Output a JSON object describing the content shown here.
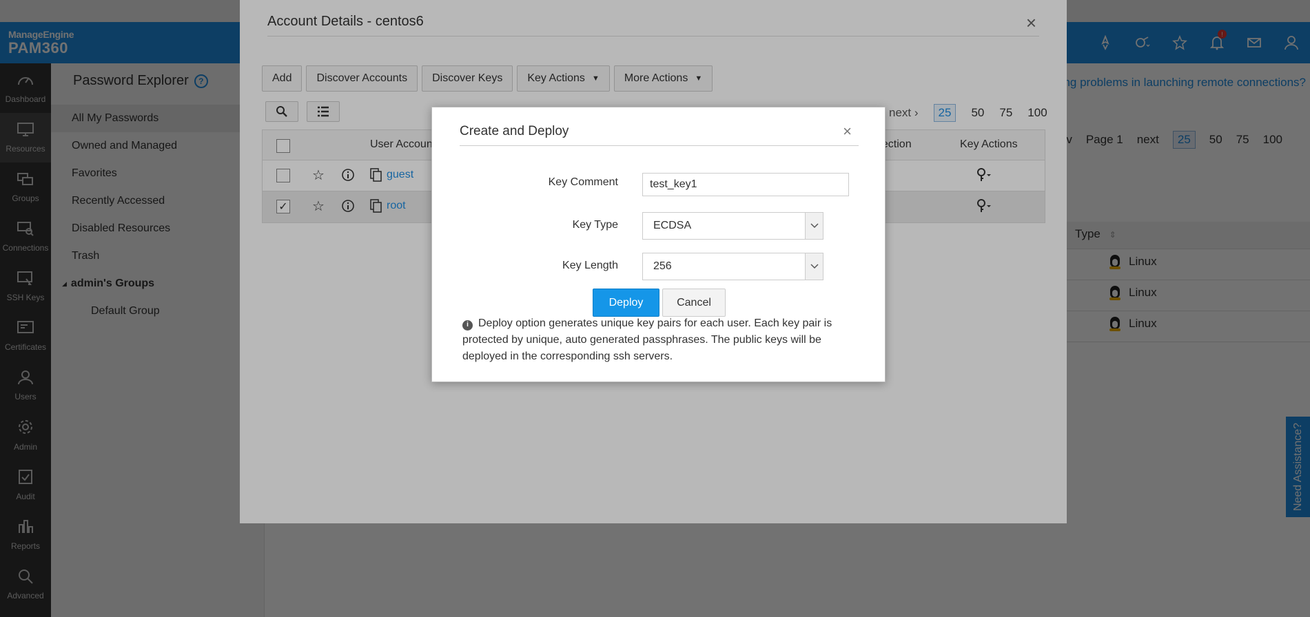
{
  "app": {
    "brand_top": "ManageEngine",
    "brand_name": "PAM360"
  },
  "header_icons": [
    "rocket-icon",
    "connection-icon",
    "user-star-icon",
    "bell-icon",
    "mail-icon",
    "user-icon"
  ],
  "notification_badge": "!",
  "leftnav": [
    {
      "label": "Dashboard",
      "icon": "dashboard-icon"
    },
    {
      "label": "Resources",
      "icon": "monitor-icon"
    },
    {
      "label": "Groups",
      "icon": "groups-icon"
    },
    {
      "label": "Connections",
      "icon": "connections-icon"
    },
    {
      "label": "SSH Keys",
      "icon": "ssh-key-icon"
    },
    {
      "label": "Certificates",
      "icon": "certificate-icon"
    },
    {
      "label": "Users",
      "icon": "user-icon"
    },
    {
      "label": "Admin",
      "icon": "gear-icon"
    },
    {
      "label": "Audit",
      "icon": "audit-icon"
    },
    {
      "label": "Reports",
      "icon": "reports-icon"
    },
    {
      "label": "Advanced",
      "icon": "analytics-icon"
    }
  ],
  "sidebar": {
    "title": "Password Explorer",
    "help": "?",
    "items": [
      "All My Passwords",
      "Owned and Managed",
      "Favorites",
      "Recently Accessed",
      "Disabled Resources",
      "Trash"
    ],
    "group_title": "admin's Groups",
    "group_items": [
      "Default Group"
    ]
  },
  "main": {
    "banner": "…ting problems in launching remote connections?",
    "pager": {
      "prev": "prev",
      "page": "Page 1",
      "next": "next",
      "sizes": [
        "25",
        "50",
        "75",
        "100"
      ]
    },
    "type_header": "Type",
    "type_rows": [
      "Linux",
      "Linux",
      "Linux"
    ]
  },
  "need_assistance": "Need Assistance?",
  "account_modal": {
    "title": "Account Details - centos6",
    "close": "×",
    "toolbar": [
      "Add",
      "Discover Accounts",
      "Discover Keys",
      "Key Actions",
      "More Actions"
    ],
    "pager": {
      "next": "next",
      "sizes": [
        "25",
        "50",
        "75",
        "100"
      ]
    },
    "columns": {
      "user_account": "User Accoun",
      "connection": "nection",
      "key_actions": "Key Actions"
    },
    "rows": [
      {
        "name": "guest",
        "checked": false
      },
      {
        "name": "root",
        "checked": true
      }
    ]
  },
  "dialog": {
    "title": "Create and Deploy",
    "close": "×",
    "key_comment_label": "Key Comment",
    "key_comment_value": "test_key1",
    "key_type_label": "Key Type",
    "key_type_value": "ECDSA",
    "key_length_label": "Key Length",
    "key_length_value": "256",
    "deploy": "Deploy",
    "cancel": "Cancel",
    "note": "Deploy option generates unique key pairs for each user. Each key pair is protected by unique, auto generated passphrases. The public keys will be deployed in the corresponding ssh servers."
  },
  "colors": {
    "brand_blue": "#1f8ce0",
    "nav_dark": "#323232",
    "deploy_blue": "#1596e8"
  }
}
